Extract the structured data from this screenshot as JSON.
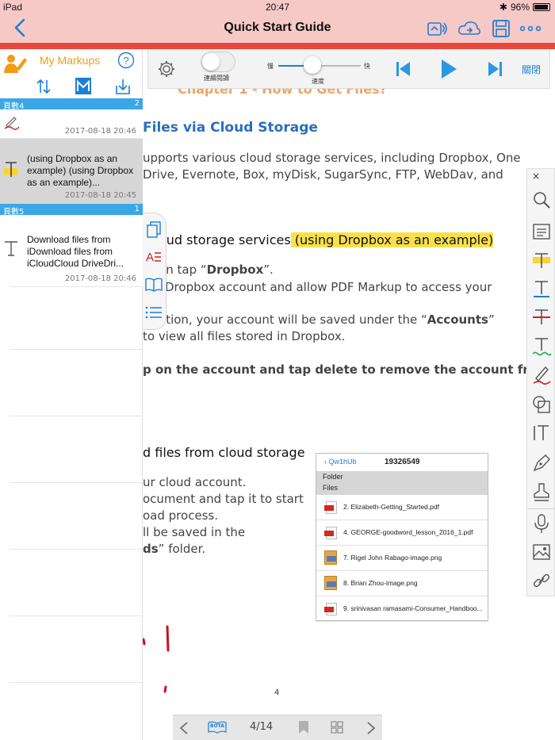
{
  "status_bar": {
    "device": "iPad",
    "time": "20:47",
    "battery": "96%"
  },
  "nav": {
    "title": "Quick Start Guide"
  },
  "reading_toolbar": {
    "continuous_label": "連續閱讀",
    "slow": "慢",
    "fast": "快",
    "speed": "速度",
    "close": "關閉"
  },
  "sidebar": {
    "title": "My Markups",
    "groups": [
      {
        "label": "頁數4",
        "count": "2"
      },
      {
        "label": "頁數5",
        "count": "1"
      }
    ],
    "items": [
      {
        "text": "",
        "date": "2017-08-18 20:46"
      },
      {
        "text": " (using Dropbox as an example) (using Dropbox as an example)...",
        "date": "2017-08-18 20:45"
      },
      {
        "text": "Download files from iDownload files from iCloudCloud   DriveDri...",
        "date": "2017-08-18 20:46"
      }
    ]
  },
  "document": {
    "chapter": "Chapter 1 - How to Get Files?",
    "h_cloud": "Files via Cloud Storage",
    "p1a": "upports various cloud storage services, including Dropbox, One",
    "p1b": "Drive, Evernote, Box, myDisk, SugarSync, FTP, WebDav, and",
    "h_services_a": "oud storage services",
    "h_services_b": " (using Dropbox as an example) ",
    "p2a_pre": "en tap “",
    "p2a_bold": "Dropbox",
    "p2a_post": "”.",
    "p2b": "Dropbox account and allow PDF Markup to access your",
    "p3a_pre": "ation, your account will be saved under the “",
    "p3a_bold": "Accounts",
    "p3a_post": "”",
    "p3b": "to view all files stored in Dropbox.",
    "p4": "p on the account and tap delete to remove the account from",
    "h_download": "d files from cloud storage",
    "p5a": "ur cloud account.",
    "p5b": "ocument and tap it to start",
    "p5c": "oad process.",
    "p5d": "ll be saved in the",
    "p5e_bold": "ds",
    "p5e_post": "” folder.",
    "page_no": "4"
  },
  "embedded": {
    "back": "Qw1hUb",
    "title": "19326549",
    "folder": "Folder",
    "files": "Files",
    "rows": [
      {
        "name": "2. Elizabeth-Getting_Started.pdf",
        "type": "pdf"
      },
      {
        "name": "4. GEORGE-goodword_lesson_2016_1.pdf",
        "type": "pdf"
      },
      {
        "name": "7. Rigel John Rabago-image.png",
        "type": "img"
      },
      {
        "name": "8. Brian Zhou-image.png",
        "type": "img"
      },
      {
        "name": "9. srinivasan ramasami-Consumer_Handboo...",
        "type": "pdf"
      }
    ]
  },
  "bottom_bar": {
    "page_indicator": "4/14",
    "mode": "BOTA"
  },
  "colors": {
    "accent": "#1a7fd8",
    "bar_pink": "#f7c9c6",
    "bar_red": "#e8473c",
    "sidebar_orange": "#f39c12",
    "group_blue": "#3aa7e6"
  }
}
